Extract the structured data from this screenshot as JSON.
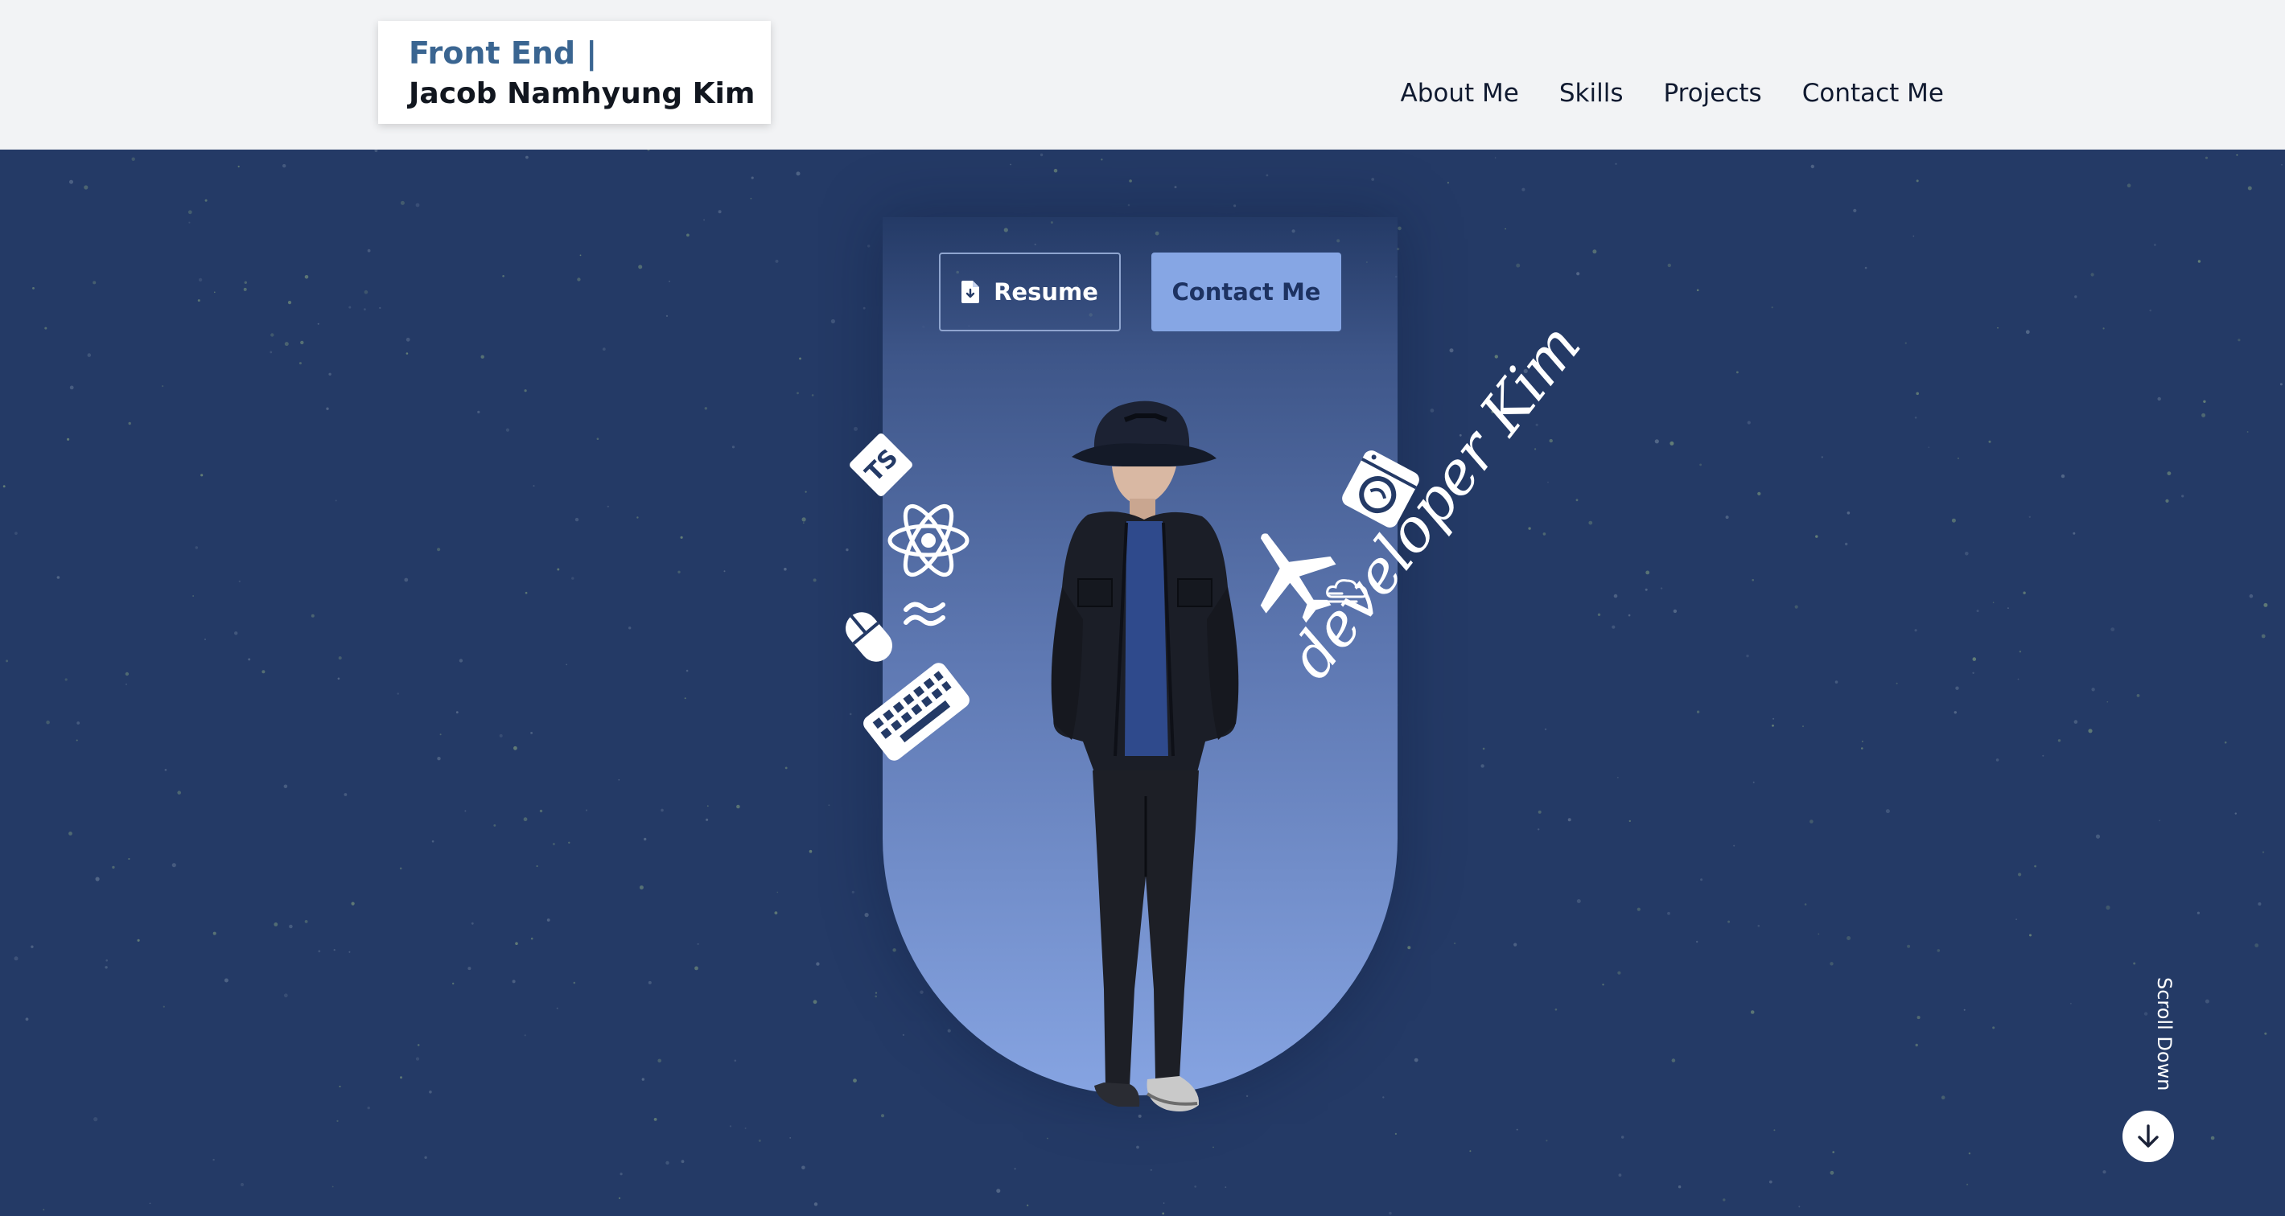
{
  "header": {
    "logo_line1": "Front End |",
    "logo_line2": "Jacob Namhyung Kim",
    "nav": [
      {
        "label": "About Me"
      },
      {
        "label": "Skills"
      },
      {
        "label": "Projects"
      },
      {
        "label": "Contact Me"
      }
    ]
  },
  "hero": {
    "resume_label": "Resume",
    "contact_label": "Contact Me",
    "script_text": "developer Kim",
    "ts_badge": "TS",
    "scroll_label": "Scroll Down"
  },
  "icons": [
    "file-download-icon",
    "typescript-icon",
    "react-icon",
    "tailwind-icon",
    "mouse-icon",
    "keyboard-icon",
    "airplane-icon",
    "cloud-icon",
    "washing-machine-icon",
    "arrow-down-icon"
  ],
  "colors": {
    "background": "#243a66",
    "header_bg": "#f2f3f5",
    "logo_accent": "#3a6591",
    "contact_button": "#86a6e4",
    "arch_bottom": "#86a4e2"
  }
}
